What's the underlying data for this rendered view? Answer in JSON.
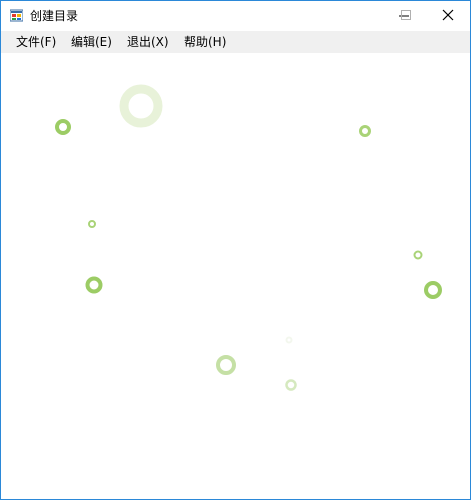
{
  "window": {
    "title": "创建目录",
    "icon": "windows-forms-app-icon",
    "controls": [
      "minimize-icon",
      "maximize-icon",
      "close-icon"
    ]
  },
  "menu": {
    "items": [
      {
        "label": "文件(F)"
      },
      {
        "label": "编辑(E)"
      },
      {
        "label": "退出(X)"
      },
      {
        "label": "帮助(H)"
      }
    ]
  },
  "canvas": {
    "decoration": "bubbles",
    "accent_color": "#9ccc65",
    "light_color": "#e8f2d9"
  }
}
